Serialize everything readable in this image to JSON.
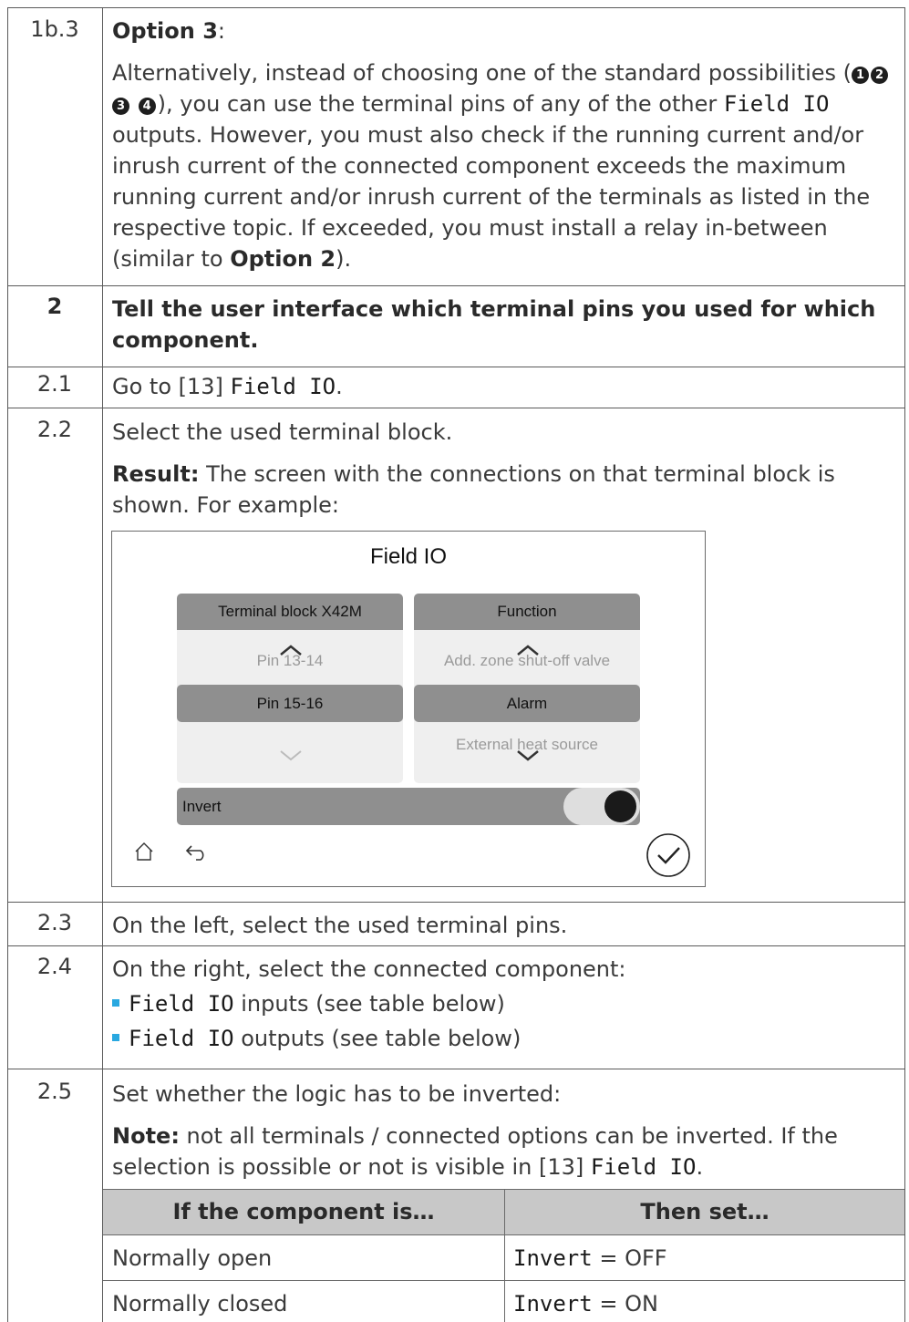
{
  "rows": {
    "r1b3": {
      "step": "1b.3",
      "heading_bold": "Option 3",
      "heading_tail": ":",
      "p_a": "Alternatively, instead of choosing one of the standard possibilities (",
      "circles": [
        "1",
        "2",
        "3",
        "4"
      ],
      "p_b": "), you can use the terminal pins of any of the other ",
      "field_io": "Field IO",
      "p_c": " outputs. However, you must also check if the running current and/or inrush current of the connected component exceeds the maximum running current and/or inrush current of the terminals as listed in the respective topic. If exceeded, you must install a relay in-between (similar to ",
      "option2": "Option 2",
      "p_d": ")."
    },
    "r2": {
      "step": "2",
      "text": "Tell the user interface which terminal pins you used for which component."
    },
    "r21": {
      "step": "2.1",
      "pre": "Go to [13] ",
      "mono": "Field IO",
      "post": "."
    },
    "r22": {
      "step": "2.2",
      "text": "Select the used terminal block.",
      "result_label": "Result:",
      "result_text": " The screen with the connections on that terminal block is shown. For example:"
    },
    "r23": {
      "step": "2.3",
      "text": "On the left, select the used terminal pins."
    },
    "r24": {
      "step": "2.4",
      "text": "On the right, select the connected component:",
      "bullets": [
        {
          "mono": "Field IO",
          "text": " inputs (see table below)"
        },
        {
          "mono": "Field IO",
          "text": " outputs (see table below)"
        }
      ]
    },
    "r25": {
      "step": "2.5",
      "text": "Set whether the logic has to be inverted:",
      "note_label": "Note:",
      "note_text": "  not all terminals / connected options can be inverted. If the selection is possible or not is visible in [13] ",
      "note_mono": "Field IO",
      "note_end": "."
    }
  },
  "screen": {
    "title": "Field IO",
    "left": {
      "header": "Terminal block X42M",
      "above": "Pin 13-14",
      "selected": "Pin 15-16"
    },
    "right": {
      "header": "Function",
      "above": "Add. zone shut-off valve",
      "selected": "Alarm",
      "below": "External heat source"
    },
    "invert_label": "Invert",
    "invert_on": true,
    "icons": [
      "home-icon",
      "back-icon",
      "confirm-icon"
    ]
  },
  "table": {
    "headers": [
      "If the component is…",
      "Then set…"
    ],
    "rows": [
      {
        "component": "Normally open",
        "mono": "Invert",
        "value": " = OFF"
      },
      {
        "component": "Normally closed",
        "mono": "Invert",
        "value": " = ON"
      }
    ]
  }
}
